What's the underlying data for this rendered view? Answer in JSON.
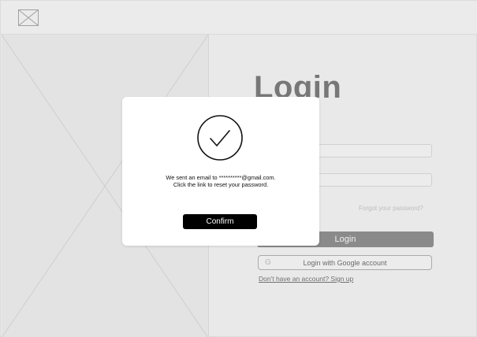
{
  "login": {
    "title": "Login",
    "forgot_password": "Forgot your password?",
    "login_button": "Login",
    "google_icon": "G",
    "google_button": "Login with Google account",
    "signup_link": "Don't have an account? Sign up"
  },
  "modal": {
    "icon": "check-circle-icon",
    "message": "We sent an email to **********@gmail.com. Click the link to reset your password.",
    "confirm_label": "Confirm"
  },
  "colors": {
    "background": "#e9e9e9",
    "primary_button": "#000000",
    "login_button": "#8a8a8a",
    "modal_background": "#ffffff"
  }
}
